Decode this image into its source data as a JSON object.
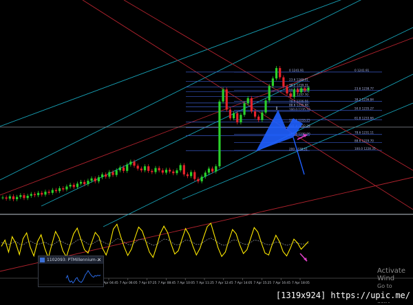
{
  "chart_data": [
    {
      "type": "candlestick",
      "title": "",
      "xlabel": "",
      "ylabel": "",
      "x_ticks": [
        "7 Apr 04:45",
        "7 Apr 06:05",
        "7 Apr 07:25",
        "7 Apr 08:45",
        "7 Apr 10:05",
        "7 Apr 11:25",
        "7 Apr 12:45",
        "7 Apr 14:05",
        "7 Apr 15:25",
        "7 Apr 16:45",
        "7 Apr 18:05"
      ],
      "ylim": [
        1218,
        1252
      ],
      "grid": false,
      "series": [
        {
          "values": [
            1220.2,
            1220.0,
            1220.4,
            1219.9,
            1220.3,
            1220.6,
            1220.1,
            1220.5,
            1220.8,
            1220.6,
            1221.0,
            1220.7,
            1221.2,
            1221.0,
            1221.5,
            1221.3,
            1221.8,
            1221.6,
            1222.1,
            1222.4,
            1222.0,
            1222.6,
            1222.9,
            1222.5,
            1223.1,
            1223.5,
            1223.0,
            1223.7,
            1224.2,
            1223.8,
            1224.6,
            1224.1,
            1224.9,
            1225.4,
            1224.8,
            1225.9,
            1226.4,
            1225.7,
            1225.2,
            1224.9,
            1225.6,
            1224.8,
            1224.6,
            1225.3,
            1224.9,
            1224.5,
            1225.0,
            1224.7,
            1224.4,
            1224.9,
            1225.8,
            1224.2,
            1223.9,
            1224.6,
            1223.4,
            1223.0,
            1223.8,
            1224.5,
            1225.2,
            1224.7,
            1225.6,
            1236.8,
            1238.9,
            1235.4,
            1233.9,
            1234.8,
            1233.2,
            1234.5,
            1236.5,
            1237.4,
            1235.1,
            1234.2,
            1233.6,
            1234.9,
            1237.0,
            1239.5,
            1240.8,
            1242.6,
            1241.0,
            1239.4,
            1238.2,
            1237.6,
            1238.9,
            1238.4,
            1239.1,
            1238.7,
            1239.2
          ]
        }
      ]
    },
    {
      "type": "fibonacci-levels",
      "levels": [
        {
          "label": "0 1241.91",
          "value": 1241.91
        },
        {
          "label": "23.6 1240.31",
          "value": 1240.31
        },
        {
          "label": "38.2 1239.31",
          "value": 1239.31
        },
        {
          "label": "50.0 1238.50",
          "value": 1238.5
        },
        {
          "label": "61.8 1237.70",
          "value": 1237.7
        },
        {
          "label": "78.6 1236.56",
          "value": 1236.56
        },
        {
          "label": "88.6 1235.88",
          "value": 1235.88
        },
        {
          "label": "100.0 1235.10",
          "value": 1235.1
        },
        {
          "label": "127.2 1233.25",
          "value": 1233.25
        },
        {
          "label": "141.4 1232.29",
          "value": 1232.29
        },
        {
          "label": "161.8 1230.90",
          "value": 1230.9
        },
        {
          "label": "200 1228.31",
          "value": 1228.31
        }
      ],
      "right_levels": [
        {
          "label": "0 1241.91",
          "value": 1241.91
        },
        {
          "label": "23.6 1238.77",
          "value": 1238.77
        },
        {
          "label": "38.2 1236.84",
          "value": 1236.84
        },
        {
          "label": "50.0 1235.27",
          "value": 1235.27
        },
        {
          "label": "61.8 1233.66",
          "value": 1233.66
        },
        {
          "label": "78.6 1231.11",
          "value": 1231.11
        },
        {
          "label": "88.6 1229.70",
          "value": 1229.7
        },
        {
          "label": "100.0 1228.35",
          "value": 1228.35
        }
      ]
    },
    {
      "type": "line",
      "series": [
        {
          "values": [
            0.42,
            0.55,
            0.3,
            0.62,
            0.48,
            0.25,
            0.58,
            0.7,
            0.4,
            0.22,
            0.52,
            0.66,
            0.38,
            0.18,
            0.47,
            0.73,
            0.59,
            0.33,
            0.2,
            0.44,
            0.68,
            0.8,
            0.57,
            0.35,
            0.28,
            0.5,
            0.71,
            0.62,
            0.38,
            0.24,
            0.46,
            0.78,
            0.88,
            0.63,
            0.41,
            0.23,
            0.36,
            0.6,
            0.82,
            0.74,
            0.52,
            0.3,
            0.19,
            0.42,
            0.69,
            0.84,
            0.71,
            0.47,
            0.26,
            0.33,
            0.57,
            0.79,
            0.66,
            0.43,
            0.24,
            0.38,
            0.61,
            0.83,
            0.9,
            0.64,
            0.39,
            0.21,
            0.3,
            0.55,
            0.77,
            0.68,
            0.45,
            0.27,
            0.35,
            0.58,
            0.81,
            0.72,
            0.49,
            0.28,
            0.24,
            0.46,
            0.65,
            0.52,
            0.31,
            0.22,
            0.38,
            0.57,
            0.49,
            0.36,
            0.44,
            0.52
          ]
        },
        {
          "values": [
            0.5,
            0.48,
            0.46,
            0.49,
            0.52,
            0.47,
            0.45,
            0.5,
            0.53,
            0.49,
            0.46,
            0.48,
            0.51,
            0.47,
            0.44,
            0.49,
            0.54,
            0.51,
            0.47,
            0.45,
            0.49,
            0.55,
            0.57,
            0.52,
            0.47,
            0.46,
            0.51,
            0.55,
            0.52,
            0.48,
            0.46,
            0.52,
            0.58,
            0.56,
            0.51,
            0.46,
            0.45,
            0.5,
            0.56,
            0.57,
            0.53,
            0.48,
            0.44,
            0.46,
            0.52,
            0.57,
            0.56,
            0.51,
            0.46,
            0.45,
            0.5,
            0.55,
            0.54,
            0.5,
            0.46,
            0.46,
            0.51,
            0.56,
            0.59,
            0.55,
            0.5,
            0.45,
            0.44,
            0.49,
            0.55,
            0.55,
            0.51,
            0.47,
            0.46,
            0.5,
            0.55,
            0.54,
            0.51,
            0.47,
            0.45,
            0.47,
            0.51,
            0.5,
            0.47,
            0.44,
            0.46,
            0.5,
            0.49,
            0.47,
            0.47,
            0.48
          ]
        }
      ]
    }
  ],
  "sub_window": {
    "title": "1102093: PTMillennium-..."
  },
  "watermark": {
    "line1": "Activate Wind",
    "line2": "Go to Settings to activ"
  },
  "colors": {
    "candle_up": "#2bd12b",
    "candle_down": "#e8232b",
    "channel": "#17a3b8",
    "fib": "#3a5ac9",
    "harmonic": "#1f5fff",
    "oscillator": "#ffea00",
    "arrow": "#e040c8"
  },
  "upic": {
    "text": "[1319x924] https://upic.me/"
  }
}
